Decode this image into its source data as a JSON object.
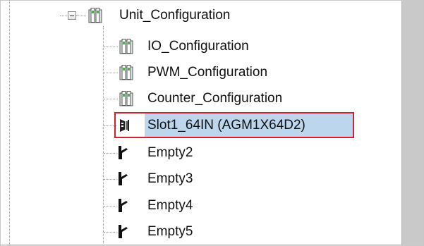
{
  "tree": {
    "root": {
      "label": "Unit_Configuration",
      "icon": "module-folder-icon",
      "expanded": true
    },
    "children": [
      {
        "label": "IO_Configuration",
        "icon": "module-folder-icon"
      },
      {
        "label": "PWM_Configuration",
        "icon": "module-folder-icon"
      },
      {
        "label": "Counter_Configuration",
        "icon": "module-folder-icon"
      },
      {
        "label": "Slot1_64IN (AGM1X64D2)",
        "icon": "slot-module-icon",
        "selected": true
      },
      {
        "label": "Empty2",
        "icon": "empty-slot-icon"
      },
      {
        "label": "Empty3",
        "icon": "empty-slot-icon"
      },
      {
        "label": "Empty4",
        "icon": "empty-slot-icon"
      },
      {
        "label": "Empty5",
        "icon": "empty-slot-icon"
      }
    ]
  },
  "colors": {
    "selection_background": "#bcd6ee",
    "highlight_border": "#d4202c",
    "scrollbar": "#c9c9c9"
  }
}
